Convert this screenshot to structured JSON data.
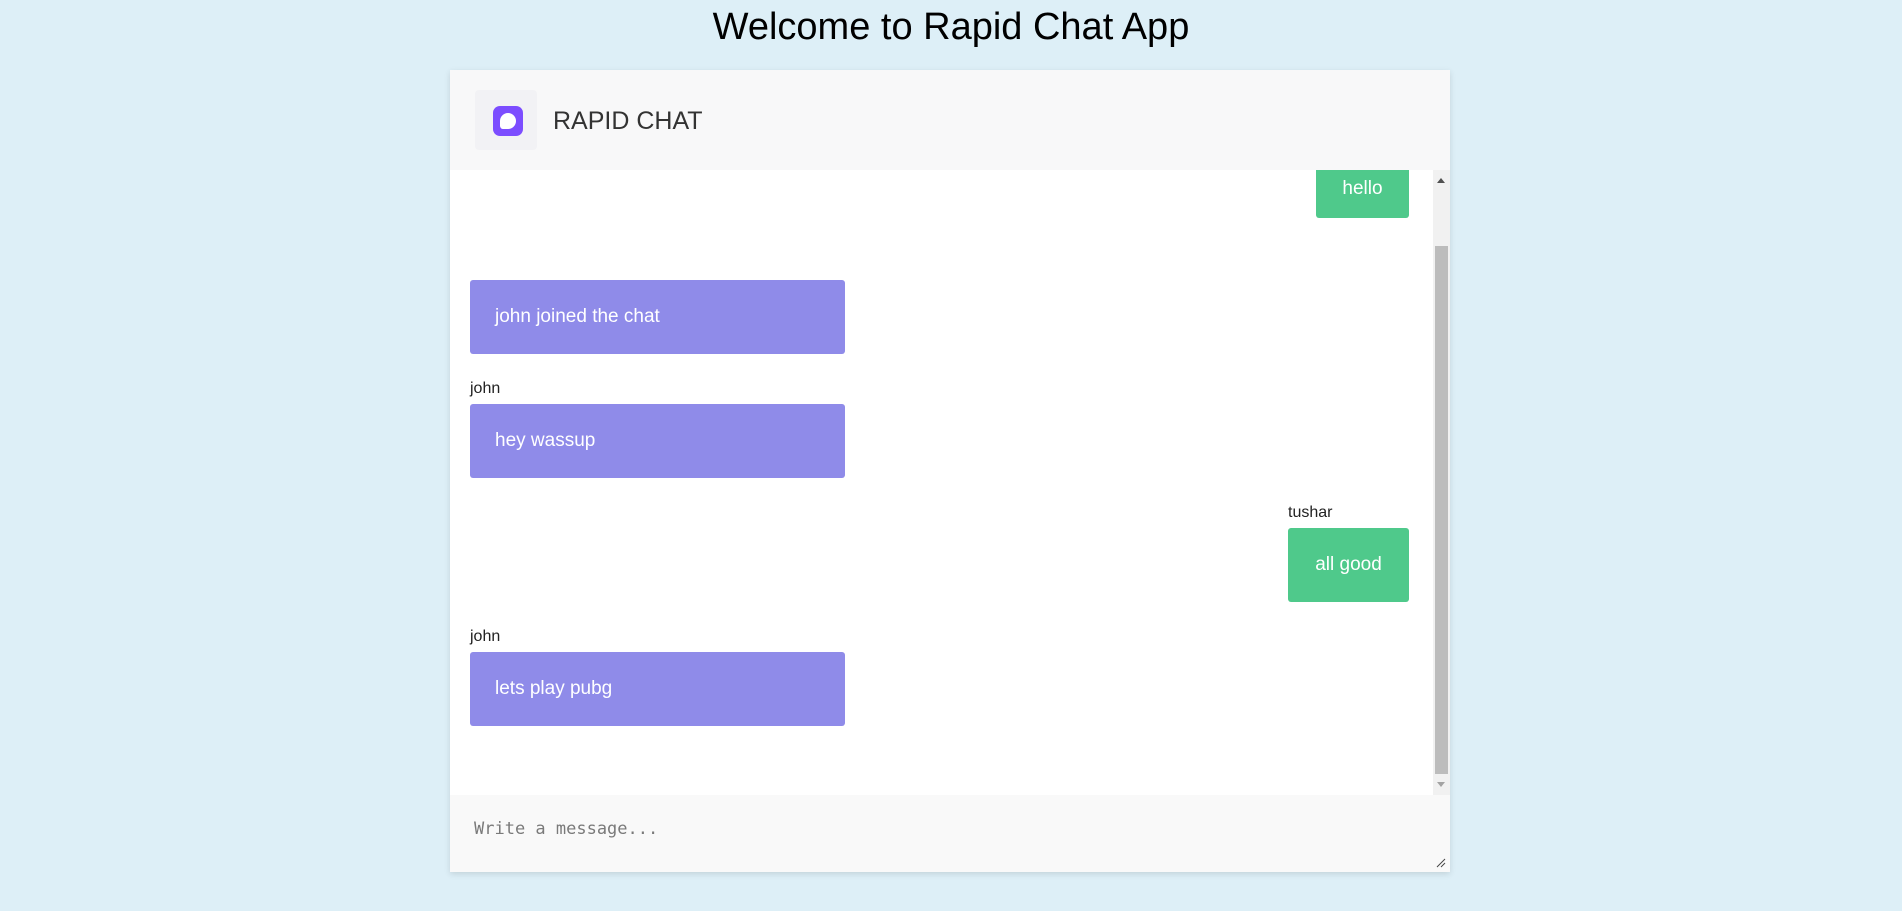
{
  "page": {
    "title": "Welcome to Rapid Chat App"
  },
  "header": {
    "app_name": "RAPID CHAT",
    "logo_icon": "chat-bubble-icon",
    "logo_color": "#7c4dff"
  },
  "messages": [
    {
      "direction": "out",
      "sender": "",
      "text": "hello"
    },
    {
      "direction": "in",
      "sender": "",
      "text": "john joined the chat"
    },
    {
      "direction": "in",
      "sender": "john",
      "text": "hey wassup"
    },
    {
      "direction": "out",
      "sender": "tushar",
      "text": "all good"
    },
    {
      "direction": "in",
      "sender": "john",
      "text": "lets play pubg"
    }
  ],
  "composer": {
    "placeholder": "Write a message...",
    "value": ""
  },
  "colors": {
    "background": "#ddeff7",
    "incoming_bubble": "#8f8be9",
    "outgoing_bubble": "#4fc98b",
    "header_bg": "#f8f8f9"
  }
}
